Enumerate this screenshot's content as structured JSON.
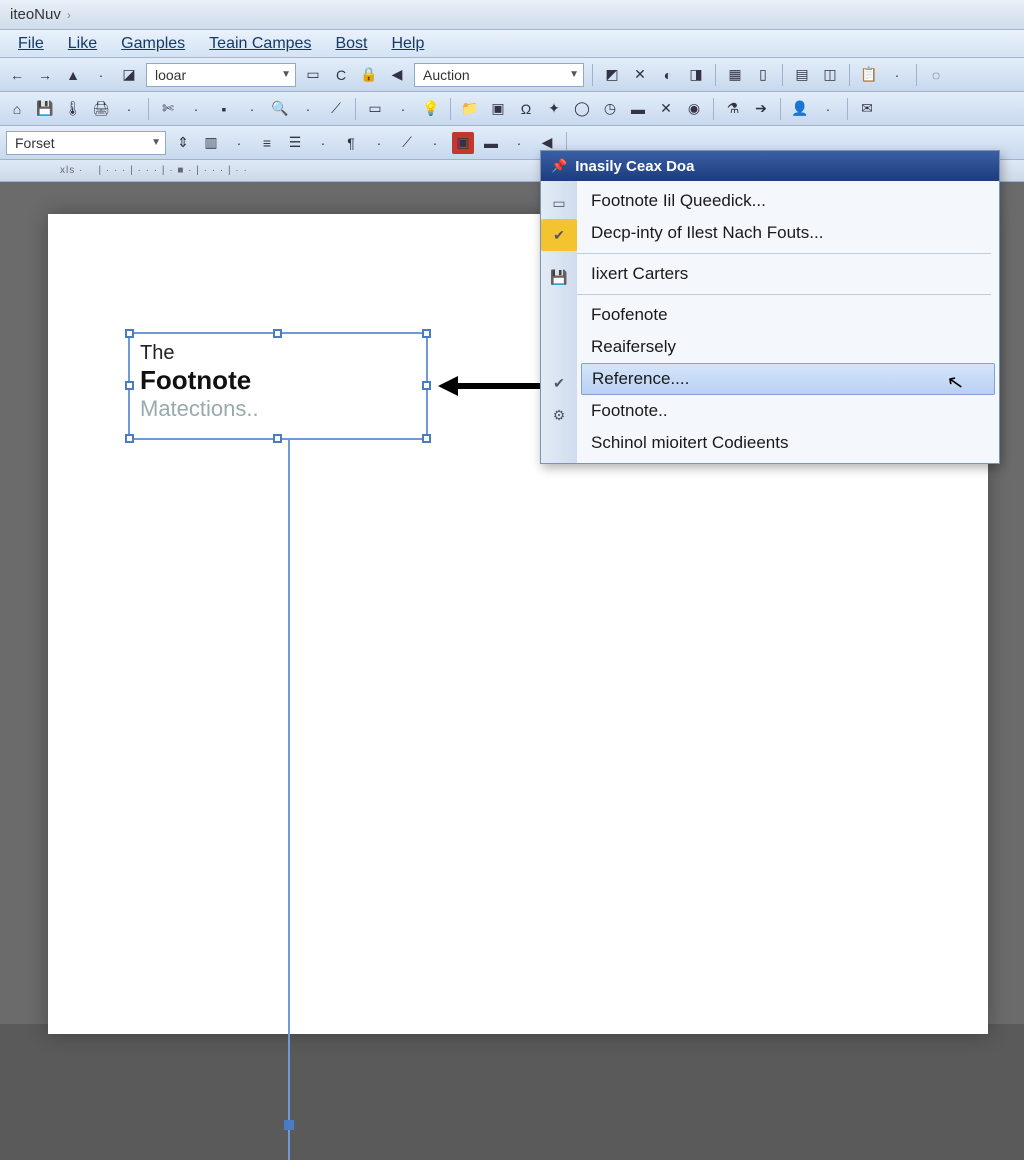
{
  "title": "iteoNuv",
  "menubar": [
    "File",
    "Like",
    "Gamples",
    "Teain Campes",
    "Bost",
    "Help"
  ],
  "combo1": "looar",
  "combo2": "Auction",
  "combo3": "Forset",
  "frame": {
    "line1": "The",
    "line2": "Footnote",
    "line3": "Matections.."
  },
  "menu": {
    "title": "Inasily Ceax Doa",
    "items": [
      {
        "label": "Footnote Iil Queedick...",
        "icon": "doc"
      },
      {
        "label": "Decp-inty of Ilest Nach Fouts...",
        "icon": "check-yellow"
      },
      {
        "label": "Iixert Carters",
        "icon": "save",
        "sepBefore": true
      },
      {
        "label": "Foofenote",
        "sepBefore": true
      },
      {
        "label": "Reaifersely"
      },
      {
        "label": "Reference....",
        "highlight": true,
        "checked": true
      },
      {
        "label": "Footnote..",
        "icon": "gear"
      },
      {
        "label": "Schinol mioitert Codieents"
      }
    ]
  }
}
